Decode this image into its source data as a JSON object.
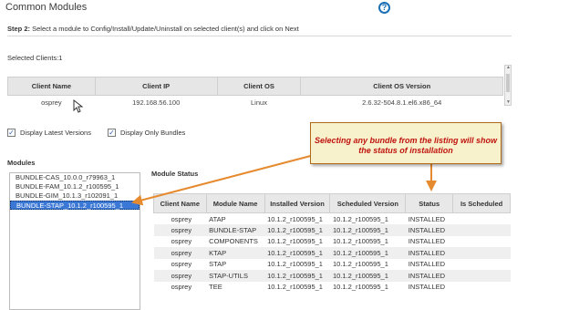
{
  "page": {
    "title": "Common Modules"
  },
  "step": {
    "label": "Step 2:",
    "text": "Select a module to Config/Install/Update/Uninstall on selected client(s) and click on Next"
  },
  "selected_clients": {
    "label": "Selected Clients:1"
  },
  "clients_table": {
    "columns": [
      "Client Name",
      "Client IP",
      "Client OS",
      "Client OS Version"
    ],
    "rows": [
      [
        "osprey",
        "192.168.56.100",
        "Linux",
        "2.6.32-504.8.1.el6.x86_64"
      ]
    ]
  },
  "options": {
    "display_latest_versions": "Display Latest Versions",
    "display_only_bundles": "Display Only Bundles"
  },
  "modules": {
    "label": "Modules",
    "items": [
      "BUNDLE-CAS_10.0.0_r79963_1",
      "BUNDLE-FAM_10.1.2_r100595_1",
      "BUNDLE-GIM_10.1.3_r102091_1",
      "BUNDLE-STAP_10.1.2_r100595_1"
    ],
    "selected_index": 3
  },
  "module_status": {
    "label": "Module Status",
    "columns": [
      "Client Name",
      "Module Name",
      "Installed Version",
      "Scheduled Version",
      "Status",
      "Is Scheduled"
    ],
    "rows": [
      [
        "osprey",
        "ATAP",
        "10.1.2_r100595_1",
        "10.1.2_r100595_1",
        "INSTALLED",
        ""
      ],
      [
        "osprey",
        "BUNDLE-STAP",
        "10.1.2_r100595_1",
        "10.1.2_r100595_1",
        "INSTALLED",
        ""
      ],
      [
        "osprey",
        "COMPONENTS",
        "10.1.2_r100595_1",
        "10.1.2_r100595_1",
        "INSTALLED",
        ""
      ],
      [
        "osprey",
        "KTAP",
        "10.1.2_r100595_1",
        "10.1.2_r100595_1",
        "INSTALLED",
        ""
      ],
      [
        "osprey",
        "STAP",
        "10.1.2_r100595_1",
        "10.1.2_r100595_1",
        "INSTALLED",
        ""
      ],
      [
        "osprey",
        "STAP-UTILS",
        "10.1.2_r100595_1",
        "10.1.2_r100595_1",
        "INSTALLED",
        ""
      ],
      [
        "osprey",
        "TEE",
        "10.1.2_r100595_1",
        "10.1.2_r100595_1",
        "INSTALLED",
        ""
      ]
    ]
  },
  "callout": {
    "text": "Selecting any bundle from the listing will show the status of installation"
  },
  "icons": {
    "help": "help-icon",
    "checkbox": "checkmark-icon",
    "cursor": "mouse-pointer-icon"
  },
  "colors": {
    "selection": "#3b78d6",
    "callout_text": "#c0140e",
    "callout_bg": "#f7f1cc",
    "arrow": "#e58a2e",
    "help": "#1a6fb5"
  }
}
